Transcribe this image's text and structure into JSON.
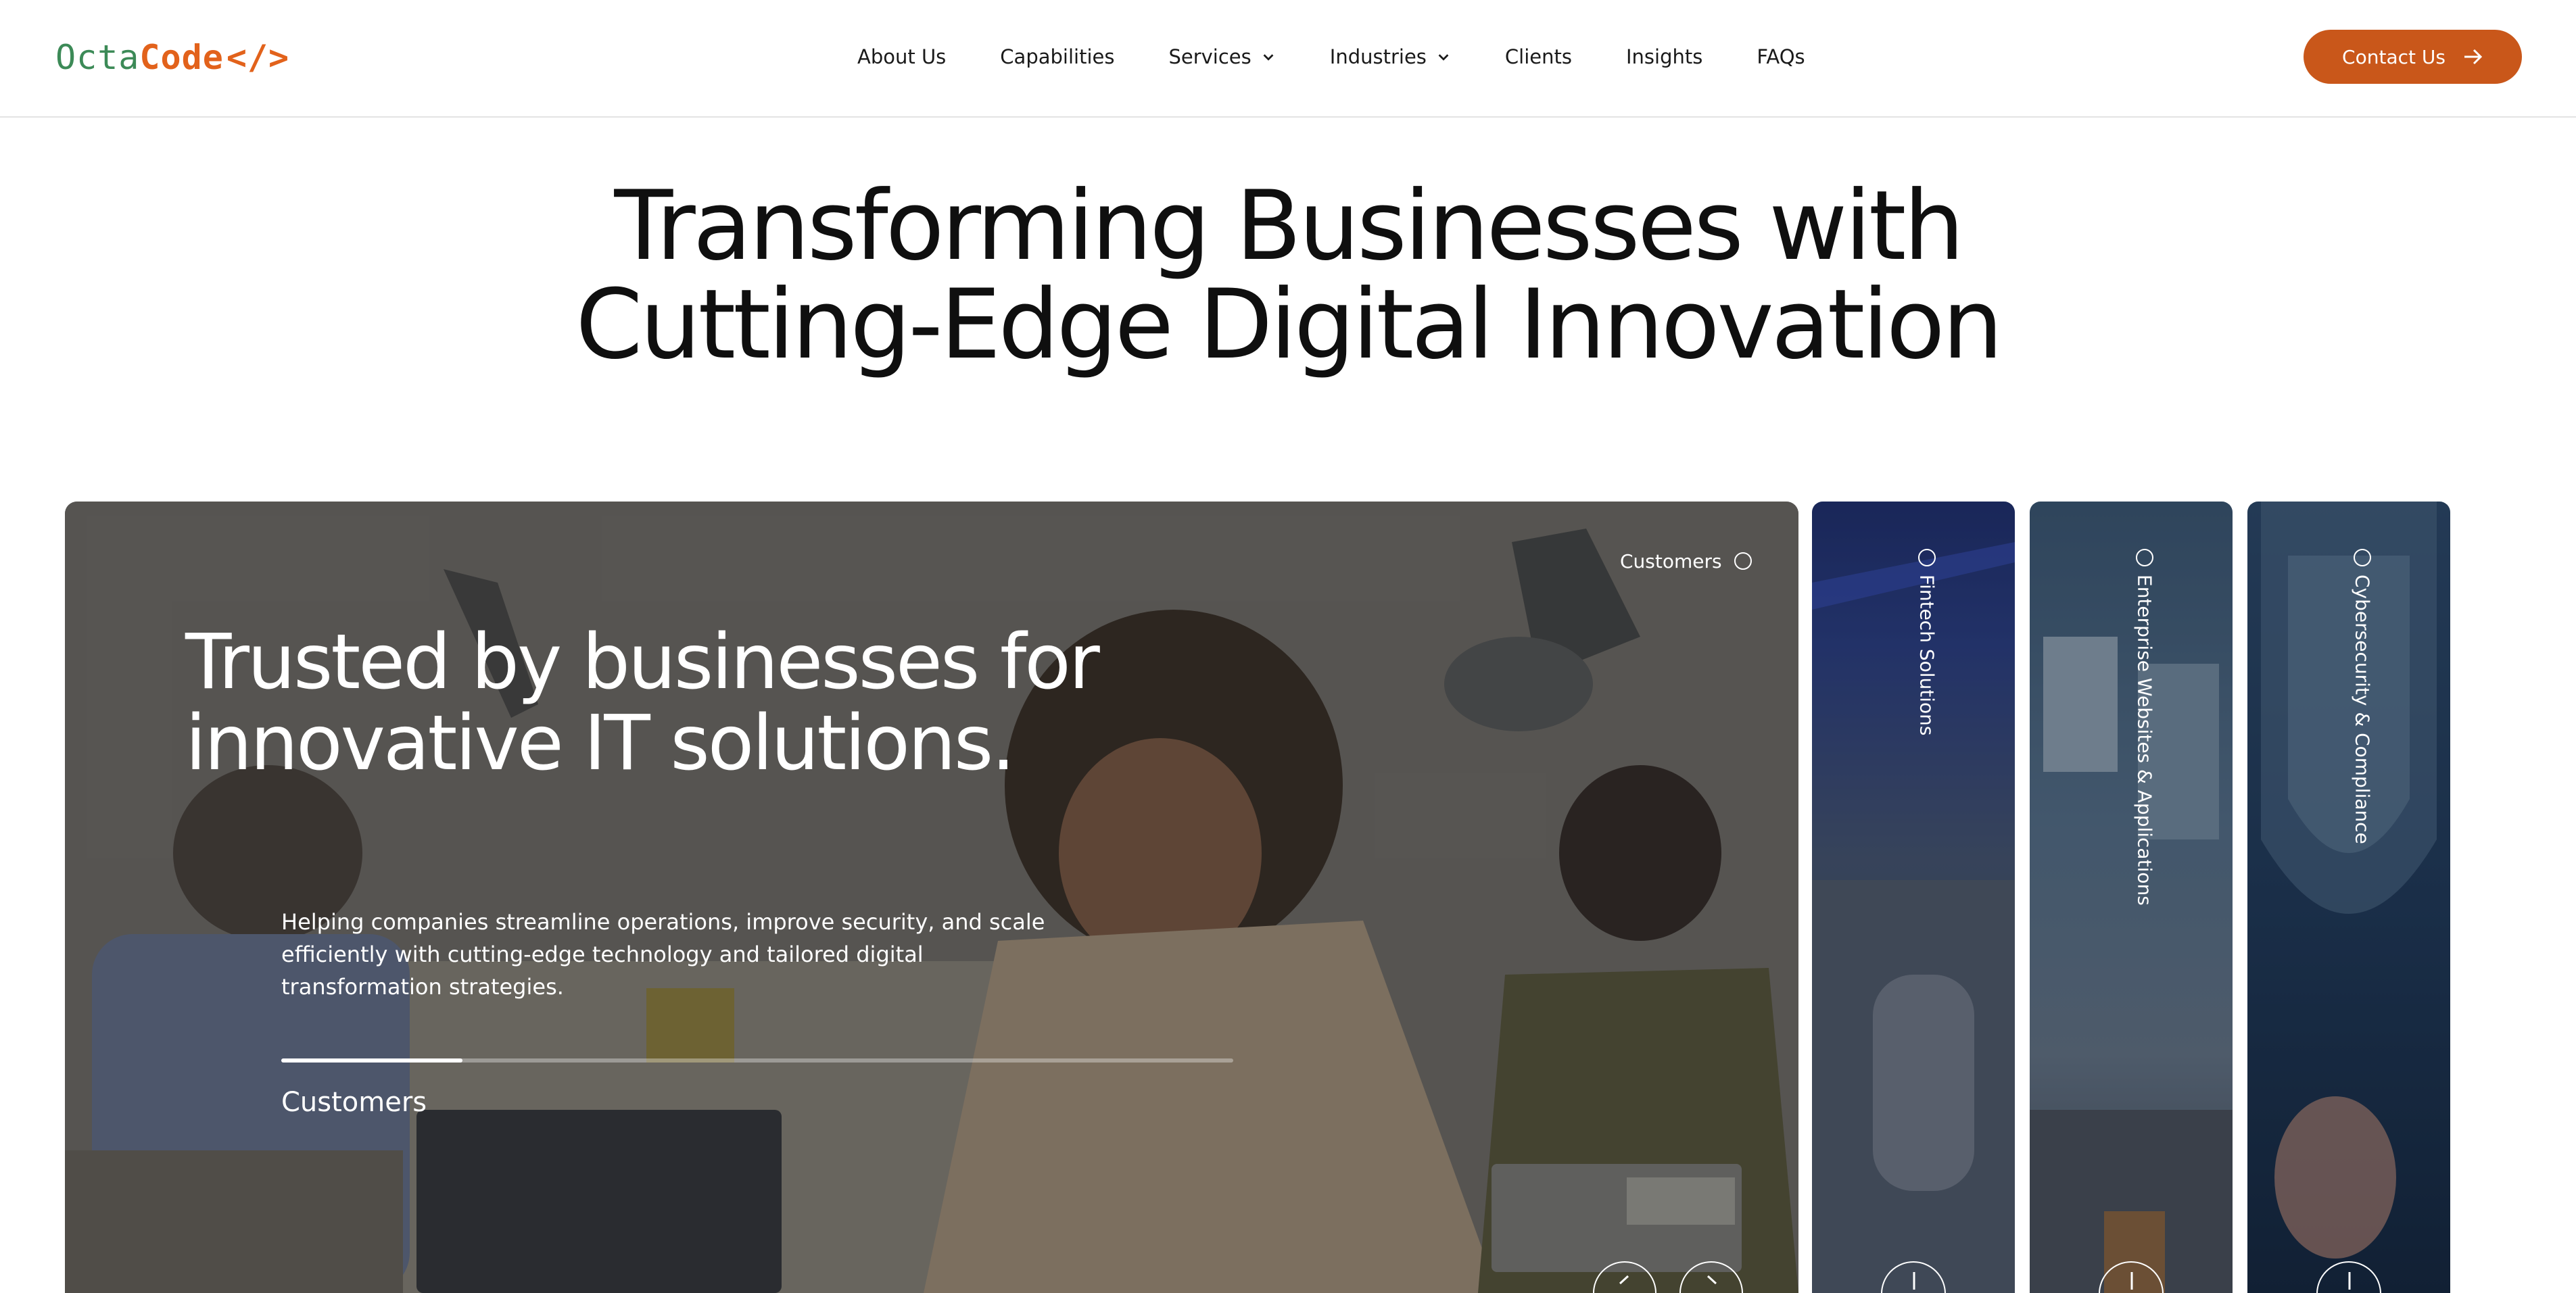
{
  "brand": {
    "logo_left": "Octa",
    "logo_right": "Code",
    "logo_tag": "</>"
  },
  "nav": {
    "items": [
      {
        "label": "About Us",
        "has_dropdown": false
      },
      {
        "label": "Capabilities",
        "has_dropdown": false
      },
      {
        "label": "Services",
        "has_dropdown": true
      },
      {
        "label": "Industries",
        "has_dropdown": true
      },
      {
        "label": "Clients",
        "has_dropdown": false
      },
      {
        "label": "Insights",
        "has_dropdown": false
      },
      {
        "label": "FAQs",
        "has_dropdown": false
      }
    ],
    "contact_label": "Contact Us"
  },
  "hero": {
    "title_line1": "Transforming Businesses with",
    "title_line2": "Cutting-Edge Digital Innovation"
  },
  "main_card": {
    "tag": "Customers",
    "heading_line1": "Trusted by businesses for",
    "heading_line2": "innovative IT solutions.",
    "description": "Helping companies streamline operations, improve security, and scale efficiently with cutting-edge technology and tailored digital transformation strategies.",
    "progress_label": "Customers",
    "progress_fraction": 0.19
  },
  "side_cards": [
    {
      "label": "Fintech Solutions"
    },
    {
      "label": "Enterprise Websites & Applications"
    },
    {
      "label": "Cybersecurity & Compliance"
    }
  ],
  "colors": {
    "brand_green": "#3c8a57",
    "brand_orange": "#e2621b",
    "button": "#c9571a"
  },
  "icons": [
    "chevron-down-icon",
    "arrow-right-icon",
    "arrow-left-icon",
    "plus-icon",
    "circle-icon"
  ]
}
